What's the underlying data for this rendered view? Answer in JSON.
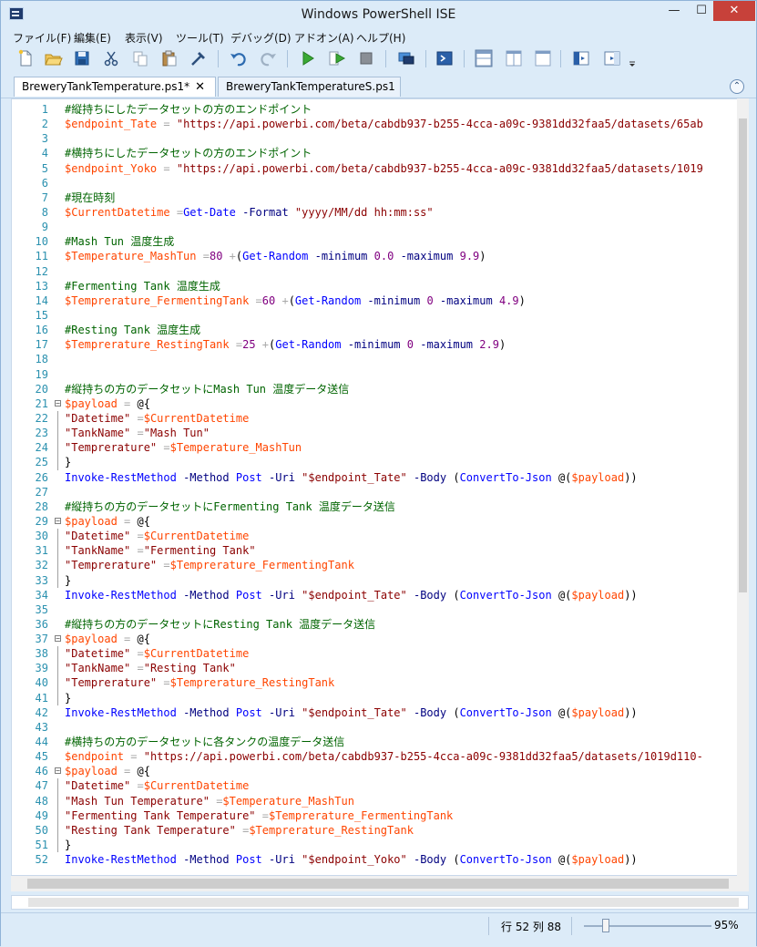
{
  "window": {
    "title": "Windows PowerShell ISE",
    "minimize": "—",
    "maximize": "☐",
    "close": "✕"
  },
  "menu": [
    {
      "label": "ファイル(F)"
    },
    {
      "label": "編集(E)"
    },
    {
      "label": "表示(V)"
    },
    {
      "label": "ツール(T)"
    },
    {
      "label": "デバッグ(D)"
    },
    {
      "label": "アドオン(A)"
    },
    {
      "label": "ヘルプ(H)"
    }
  ],
  "tabs": [
    {
      "label": "BreweryTankTemperature.ps1*",
      "active": true,
      "close": "✕"
    },
    {
      "label": "BreweryTankTemperatureS.ps1",
      "active": false
    }
  ],
  "collapse_glyph": "⌃",
  "colors": {
    "comment": "#006400",
    "variable": "#ff4500",
    "string": "#8b0000",
    "command": "#0000ff",
    "parameter": "#000080",
    "operator": "#a9a9a9",
    "number": "#800080",
    "line_number": "#2b91af"
  },
  "code_lines": [
    {
      "n": "1",
      "fold": "",
      "tokens": [
        [
          "comment",
          "#縦持ちにしたデータセットの方のエンドポイント"
        ]
      ]
    },
    {
      "n": "2",
      "fold": "",
      "tokens": [
        [
          "var",
          "$endpoint_Tate"
        ],
        [
          "plain",
          " "
        ],
        [
          "op",
          "="
        ],
        [
          "plain",
          " "
        ],
        [
          "str",
          "\"https://api.powerbi.com/beta/cabdb937-b255-4cca-a09c-9381dd32faa5/datasets/65ab"
        ]
      ]
    },
    {
      "n": "3",
      "fold": "",
      "tokens": []
    },
    {
      "n": "4",
      "fold": "",
      "tokens": [
        [
          "comment",
          "#横持ちにしたデータセットの方のエンドポイント"
        ]
      ]
    },
    {
      "n": "5",
      "fold": "",
      "tokens": [
        [
          "var",
          "$endpoint_Yoko"
        ],
        [
          "plain",
          " "
        ],
        [
          "op",
          "="
        ],
        [
          "plain",
          " "
        ],
        [
          "str",
          "\"https://api.powerbi.com/beta/cabdb937-b255-4cca-a09c-9381dd32faa5/datasets/1019"
        ]
      ]
    },
    {
      "n": "6",
      "fold": "",
      "tokens": []
    },
    {
      "n": "7",
      "fold": "",
      "tokens": [
        [
          "comment",
          "#現在時刻"
        ]
      ]
    },
    {
      "n": "8",
      "fold": "",
      "tokens": [
        [
          "var",
          "$CurrentDatetime"
        ],
        [
          "plain",
          " "
        ],
        [
          "op",
          "="
        ],
        [
          "cmd",
          "Get-Date"
        ],
        [
          "plain",
          " "
        ],
        [
          "param",
          "-Format"
        ],
        [
          "plain",
          " "
        ],
        [
          "str",
          "\"yyyy/MM/dd hh:mm:ss\""
        ]
      ]
    },
    {
      "n": "9",
      "fold": "",
      "tokens": []
    },
    {
      "n": "10",
      "fold": "",
      "tokens": [
        [
          "comment",
          "#Mash Tun 温度生成"
        ]
      ]
    },
    {
      "n": "11",
      "fold": "",
      "tokens": [
        [
          "var",
          "$Temperature_MashTun"
        ],
        [
          "plain",
          " "
        ],
        [
          "op",
          "="
        ],
        [
          "num",
          "80"
        ],
        [
          "plain",
          " "
        ],
        [
          "op",
          "+"
        ],
        [
          "plain",
          "("
        ],
        [
          "cmd",
          "Get-Random"
        ],
        [
          "plain",
          " "
        ],
        [
          "param",
          "-minimum"
        ],
        [
          "plain",
          " "
        ],
        [
          "num",
          "0.0"
        ],
        [
          "plain",
          " "
        ],
        [
          "param",
          "-maximum"
        ],
        [
          "plain",
          " "
        ],
        [
          "num",
          "9.9"
        ],
        [
          "plain",
          ")"
        ]
      ]
    },
    {
      "n": "12",
      "fold": "",
      "tokens": []
    },
    {
      "n": "13",
      "fold": "",
      "tokens": [
        [
          "comment",
          "#Fermenting Tank 温度生成"
        ]
      ]
    },
    {
      "n": "14",
      "fold": "",
      "tokens": [
        [
          "var",
          "$Temprerature_FermentingTank"
        ],
        [
          "plain",
          " "
        ],
        [
          "op",
          "="
        ],
        [
          "num",
          "60"
        ],
        [
          "plain",
          " "
        ],
        [
          "op",
          "+"
        ],
        [
          "plain",
          "("
        ],
        [
          "cmd",
          "Get-Random"
        ],
        [
          "plain",
          " "
        ],
        [
          "param",
          "-minimum"
        ],
        [
          "plain",
          " "
        ],
        [
          "num",
          "0"
        ],
        [
          "plain",
          " "
        ],
        [
          "param",
          "-maximum"
        ],
        [
          "plain",
          " "
        ],
        [
          "num",
          "4.9"
        ],
        [
          "plain",
          ")"
        ]
      ]
    },
    {
      "n": "15",
      "fold": "",
      "tokens": []
    },
    {
      "n": "16",
      "fold": "",
      "tokens": [
        [
          "comment",
          "#Resting Tank 温度生成"
        ]
      ]
    },
    {
      "n": "17",
      "fold": "",
      "tokens": [
        [
          "var",
          "$Temprerature_RestingTank"
        ],
        [
          "plain",
          " "
        ],
        [
          "op",
          "="
        ],
        [
          "num",
          "25"
        ],
        [
          "plain",
          " "
        ],
        [
          "op",
          "+"
        ],
        [
          "plain",
          "("
        ],
        [
          "cmd",
          "Get-Random"
        ],
        [
          "plain",
          " "
        ],
        [
          "param",
          "-minimum"
        ],
        [
          "plain",
          " "
        ],
        [
          "num",
          "0"
        ],
        [
          "plain",
          " "
        ],
        [
          "param",
          "-maximum"
        ],
        [
          "plain",
          " "
        ],
        [
          "num",
          "2.9"
        ],
        [
          "plain",
          ")"
        ]
      ]
    },
    {
      "n": "18",
      "fold": "",
      "tokens": []
    },
    {
      "n": "19",
      "fold": "",
      "tokens": []
    },
    {
      "n": "20",
      "fold": "",
      "tokens": [
        [
          "comment",
          "#縦持ちの方のデータセットにMash Tun 温度データ送信"
        ]
      ]
    },
    {
      "n": "21",
      "fold": "open",
      "tokens": [
        [
          "var",
          "$payload"
        ],
        [
          "plain",
          " "
        ],
        [
          "op",
          "="
        ],
        [
          "plain",
          " @{"
        ]
      ]
    },
    {
      "n": "22",
      "fold": "guide",
      "tokens": [
        [
          "str",
          "\"Datetime\""
        ],
        [
          "plain",
          " "
        ],
        [
          "op",
          "="
        ],
        [
          "var",
          "$CurrentDatetime"
        ]
      ]
    },
    {
      "n": "23",
      "fold": "guide",
      "tokens": [
        [
          "str",
          "\"TankName\""
        ],
        [
          "plain",
          " "
        ],
        [
          "op",
          "="
        ],
        [
          "str",
          "\"Mash Tun\""
        ]
      ]
    },
    {
      "n": "24",
      "fold": "guide",
      "tokens": [
        [
          "str",
          "\"Temprerature\""
        ],
        [
          "plain",
          " "
        ],
        [
          "op",
          "="
        ],
        [
          "var",
          "$Temperature_MashTun"
        ]
      ]
    },
    {
      "n": "25",
      "fold": "guide",
      "tokens": [
        [
          "plain",
          "}"
        ]
      ]
    },
    {
      "n": "26",
      "fold": "",
      "tokens": [
        [
          "cmd",
          "Invoke-RestMethod"
        ],
        [
          "plain",
          " "
        ],
        [
          "param",
          "-Method"
        ],
        [
          "plain",
          " "
        ],
        [
          "cmd",
          "Post"
        ],
        [
          "plain",
          " "
        ],
        [
          "param",
          "-Uri"
        ],
        [
          "plain",
          " "
        ],
        [
          "str",
          "\"$endpoint_Tate\""
        ],
        [
          "plain",
          " "
        ],
        [
          "param",
          "-Body"
        ],
        [
          "plain",
          " ("
        ],
        [
          "cmd",
          "ConvertTo-Json"
        ],
        [
          "plain",
          " @("
        ],
        [
          "var",
          "$payload"
        ],
        [
          "plain",
          "))"
        ]
      ]
    },
    {
      "n": "27",
      "fold": "",
      "tokens": []
    },
    {
      "n": "28",
      "fold": "",
      "tokens": [
        [
          "comment",
          "#縦持ちの方のデータセットにFermenting Tank 温度データ送信"
        ]
      ]
    },
    {
      "n": "29",
      "fold": "open",
      "tokens": [
        [
          "var",
          "$payload"
        ],
        [
          "plain",
          " "
        ],
        [
          "op",
          "="
        ],
        [
          "plain",
          " @{"
        ]
      ]
    },
    {
      "n": "30",
      "fold": "guide",
      "tokens": [
        [
          "str",
          "\"Datetime\""
        ],
        [
          "plain",
          " "
        ],
        [
          "op",
          "="
        ],
        [
          "var",
          "$CurrentDatetime"
        ]
      ]
    },
    {
      "n": "31",
      "fold": "guide",
      "tokens": [
        [
          "str",
          "\"TankName\""
        ],
        [
          "plain",
          " "
        ],
        [
          "op",
          "="
        ],
        [
          "str",
          "\"Fermenting Tank\""
        ]
      ]
    },
    {
      "n": "32",
      "fold": "guide",
      "tokens": [
        [
          "str",
          "\"Temprerature\""
        ],
        [
          "plain",
          " "
        ],
        [
          "op",
          "="
        ],
        [
          "var",
          "$Temprerature_FermentingTank"
        ]
      ]
    },
    {
      "n": "33",
      "fold": "guide",
      "tokens": [
        [
          "plain",
          "}"
        ]
      ]
    },
    {
      "n": "34",
      "fold": "",
      "tokens": [
        [
          "cmd",
          "Invoke-RestMethod"
        ],
        [
          "plain",
          " "
        ],
        [
          "param",
          "-Method"
        ],
        [
          "plain",
          " "
        ],
        [
          "cmd",
          "Post"
        ],
        [
          "plain",
          " "
        ],
        [
          "param",
          "-Uri"
        ],
        [
          "plain",
          " "
        ],
        [
          "str",
          "\"$endpoint_Tate\""
        ],
        [
          "plain",
          " "
        ],
        [
          "param",
          "-Body"
        ],
        [
          "plain",
          " ("
        ],
        [
          "cmd",
          "ConvertTo-Json"
        ],
        [
          "plain",
          " @("
        ],
        [
          "var",
          "$payload"
        ],
        [
          "plain",
          "))"
        ]
      ]
    },
    {
      "n": "35",
      "fold": "",
      "tokens": []
    },
    {
      "n": "36",
      "fold": "",
      "tokens": [
        [
          "comment",
          "#縦持ちの方のデータセットにResting Tank 温度データ送信"
        ]
      ]
    },
    {
      "n": "37",
      "fold": "open",
      "tokens": [
        [
          "var",
          "$payload"
        ],
        [
          "plain",
          " "
        ],
        [
          "op",
          "="
        ],
        [
          "plain",
          " @{"
        ]
      ]
    },
    {
      "n": "38",
      "fold": "guide",
      "tokens": [
        [
          "str",
          "\"Datetime\""
        ],
        [
          "plain",
          " "
        ],
        [
          "op",
          "="
        ],
        [
          "var",
          "$CurrentDatetime"
        ]
      ]
    },
    {
      "n": "39",
      "fold": "guide",
      "tokens": [
        [
          "str",
          "\"TankName\""
        ],
        [
          "plain",
          " "
        ],
        [
          "op",
          "="
        ],
        [
          "str",
          "\"Resting Tank\""
        ]
      ]
    },
    {
      "n": "40",
      "fold": "guide",
      "tokens": [
        [
          "str",
          "\"Temprerature\""
        ],
        [
          "plain",
          " "
        ],
        [
          "op",
          "="
        ],
        [
          "var",
          "$Temprerature_RestingTank"
        ]
      ]
    },
    {
      "n": "41",
      "fold": "guide",
      "tokens": [
        [
          "plain",
          "}"
        ]
      ]
    },
    {
      "n": "42",
      "fold": "",
      "tokens": [
        [
          "cmd",
          "Invoke-RestMethod"
        ],
        [
          "plain",
          " "
        ],
        [
          "param",
          "-Method"
        ],
        [
          "plain",
          " "
        ],
        [
          "cmd",
          "Post"
        ],
        [
          "plain",
          " "
        ],
        [
          "param",
          "-Uri"
        ],
        [
          "plain",
          " "
        ],
        [
          "str",
          "\"$endpoint_Tate\""
        ],
        [
          "plain",
          " "
        ],
        [
          "param",
          "-Body"
        ],
        [
          "plain",
          " ("
        ],
        [
          "cmd",
          "ConvertTo-Json"
        ],
        [
          "plain",
          " @("
        ],
        [
          "var",
          "$payload"
        ],
        [
          "plain",
          "))"
        ]
      ]
    },
    {
      "n": "43",
      "fold": "",
      "tokens": []
    },
    {
      "n": "44",
      "fold": "",
      "tokens": [
        [
          "comment",
          "#横持ちの方のデータセットに各タンクの温度データ送信"
        ]
      ]
    },
    {
      "n": "45",
      "fold": "",
      "tokens": [
        [
          "var",
          "$endpoint"
        ],
        [
          "plain",
          " "
        ],
        [
          "op",
          "="
        ],
        [
          "plain",
          " "
        ],
        [
          "str",
          "\"https://api.powerbi.com/beta/cabdb937-b255-4cca-a09c-9381dd32faa5/datasets/1019d110-"
        ]
      ]
    },
    {
      "n": "46",
      "fold": "open",
      "tokens": [
        [
          "var",
          "$payload"
        ],
        [
          "plain",
          " "
        ],
        [
          "op",
          "="
        ],
        [
          "plain",
          " @{"
        ]
      ]
    },
    {
      "n": "47",
      "fold": "guide",
      "tokens": [
        [
          "str",
          "\"Datetime\""
        ],
        [
          "plain",
          " "
        ],
        [
          "op",
          "="
        ],
        [
          "var",
          "$CurrentDatetime"
        ]
      ]
    },
    {
      "n": "48",
      "fold": "guide",
      "tokens": [
        [
          "str",
          "\"Mash Tun Temperature\""
        ],
        [
          "plain",
          " "
        ],
        [
          "op",
          "="
        ],
        [
          "var",
          "$Temperature_MashTun"
        ]
      ]
    },
    {
      "n": "49",
      "fold": "guide",
      "tokens": [
        [
          "str",
          "\"Fermenting Tank Temperature\""
        ],
        [
          "plain",
          " "
        ],
        [
          "op",
          "="
        ],
        [
          "var",
          "$Temprerature_FermentingTank"
        ]
      ]
    },
    {
      "n": "50",
      "fold": "guide",
      "tokens": [
        [
          "str",
          "\"Resting Tank Temperature\""
        ],
        [
          "plain",
          " "
        ],
        [
          "op",
          "="
        ],
        [
          "var",
          "$Temprerature_RestingTank"
        ]
      ]
    },
    {
      "n": "51",
      "fold": "guide",
      "tokens": [
        [
          "plain",
          "}"
        ]
      ]
    },
    {
      "n": "52",
      "fold": "",
      "tokens": [
        [
          "cmd",
          "Invoke-RestMethod"
        ],
        [
          "plain",
          " "
        ],
        [
          "param",
          "-Method"
        ],
        [
          "plain",
          " "
        ],
        [
          "cmd",
          "Post"
        ],
        [
          "plain",
          " "
        ],
        [
          "param",
          "-Uri"
        ],
        [
          "plain",
          " "
        ],
        [
          "str",
          "\"$endpoint_Yoko\""
        ],
        [
          "plain",
          " "
        ],
        [
          "param",
          "-Body"
        ],
        [
          "plain",
          " ("
        ],
        [
          "cmd",
          "ConvertTo-Json"
        ],
        [
          "plain",
          " @("
        ],
        [
          "var",
          "$payload"
        ],
        [
          "plain",
          "))"
        ]
      ]
    }
  ],
  "status": {
    "position": "行 52 列 88",
    "zoom": "95%",
    "zoom_level": 0.95
  }
}
